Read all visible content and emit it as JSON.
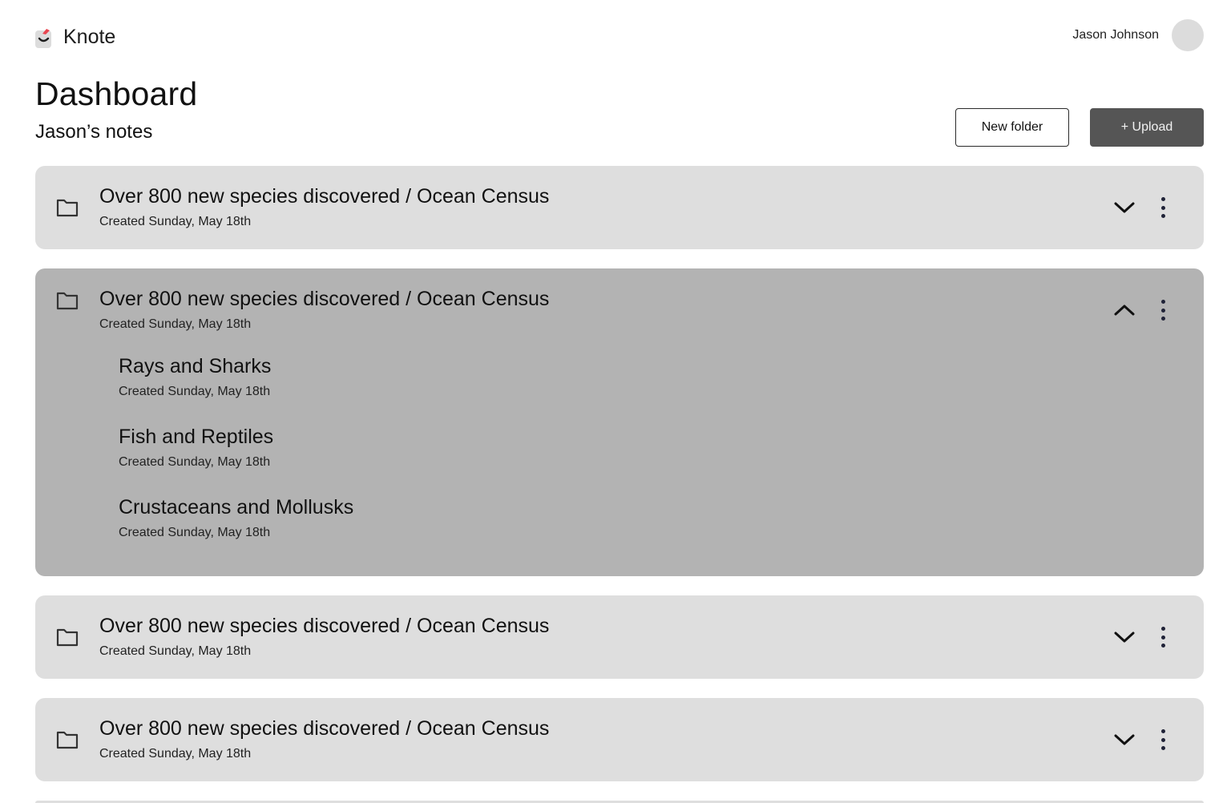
{
  "app": {
    "name": "Knote"
  },
  "user": {
    "name": "Jason Johnson"
  },
  "page": {
    "title": "Dashboard",
    "subtitle": "Jason’s notes"
  },
  "actions": {
    "new_folder_label": "New folder",
    "upload_label": "+ Upload"
  },
  "icons": {
    "folder": "folder-icon",
    "expand": "chevron-down-icon",
    "collapse": "chevron-up-icon",
    "more": "more-vertical-icon"
  },
  "colors": {
    "card": "#dedede",
    "card_expanded": "#b3b3b3",
    "upload_button": "#555555",
    "logo_accent": "#e8454f"
  },
  "folders": [
    {
      "title": "Over 800 new species discovered / Ocean Census",
      "date": "Created Sunday, May 18th",
      "expanded": false
    },
    {
      "title": "Over 800 new species discovered / Ocean Census",
      "date": "Created Sunday, May 18th",
      "expanded": true,
      "notes": [
        {
          "title": "Rays and Sharks",
          "date": "Created Sunday, May 18th"
        },
        {
          "title": "Fish and Reptiles",
          "date": "Created Sunday, May 18th"
        },
        {
          "title": "Crustaceans and Mollusks",
          "date": "Created Sunday, May 18th"
        }
      ]
    },
    {
      "title": "Over 800 new species discovered / Ocean Census",
      "date": "Created Sunday, May 18th",
      "expanded": false
    },
    {
      "title": "Over 800 new species discovered / Ocean Census",
      "date": "Created Sunday, May 18th",
      "expanded": false
    }
  ]
}
